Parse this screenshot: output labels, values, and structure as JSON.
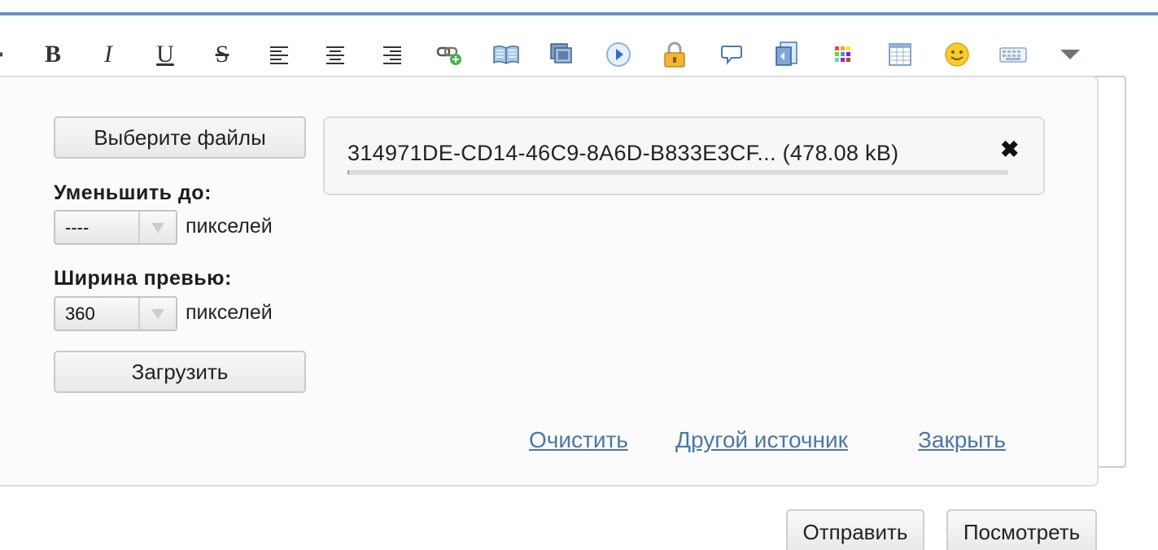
{
  "toolbar": {
    "text_buttons": [
      {
        "name": "bold-button",
        "label": "B"
      },
      {
        "name": "italic-button",
        "label": "I"
      },
      {
        "name": "underline-button",
        "label": "U"
      },
      {
        "name": "strikethrough-button",
        "label": "S"
      }
    ],
    "icons": [
      "align-left-icon",
      "align-center-icon",
      "align-right-icon",
      "link-icon",
      "book-icon",
      "image-icon",
      "media-icon",
      "lock-icon",
      "speech-bubble-icon",
      "document-icon",
      "color-grid-icon",
      "table-icon",
      "smiley-icon",
      "keyboard-icon",
      "more-dropdown-icon"
    ]
  },
  "upload": {
    "choose_files_label": "Выберите файлы",
    "reduce_label": "Уменьшить до:",
    "reduce_value": "----",
    "reduce_unit": "пикселей",
    "preview_label": "Ширина превью:",
    "preview_value": "360",
    "preview_unit": "пикселей",
    "upload_label": "Загрузить",
    "file": {
      "name": "314971DE-CD14-46C9-8A6D-B833E3CF... (478.08 kB)",
      "remove_glyph": "✖",
      "progress_percent": 0
    },
    "links": {
      "clear": "Очистить",
      "other_source": "Другой источник",
      "close": "Закрыть"
    }
  },
  "actions": {
    "submit": "Отправить",
    "preview": "Посмотреть"
  },
  "colors": {
    "accent_line": "#6b93bd",
    "link": "#4a78a6"
  }
}
